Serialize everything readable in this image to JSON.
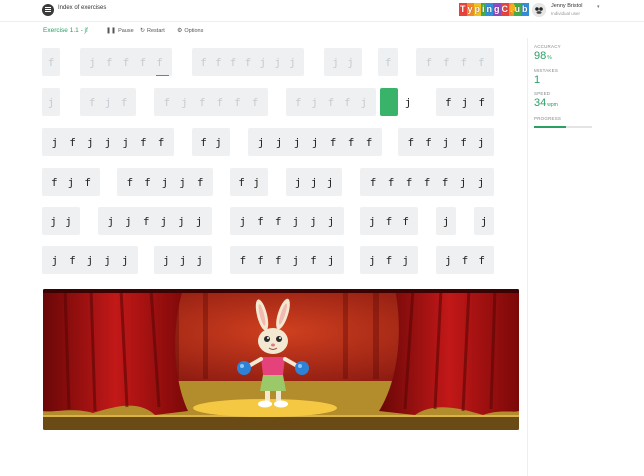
{
  "header": {
    "index_label": "Index of exercises",
    "logo_letters": [
      "T",
      "y",
      "p",
      "i",
      "n",
      "g",
      "C",
      "l",
      "u",
      "b"
    ],
    "logo_colors": [
      "#e8433b",
      "#f08a2b",
      "#f0c21f",
      "#3fae49",
      "#2f8fd8",
      "#8a4cc4",
      "#e8433b",
      "#f08a2b",
      "#3fae49",
      "#2f8fd8"
    ],
    "user_name": "Jenny Bristol",
    "user_type": "Individual user"
  },
  "toolbar": {
    "exercise_title": "Exercise 1.1 - jf",
    "pause_label": "Pause",
    "restart_label": "Restart",
    "options_label": "Options"
  },
  "stats": {
    "accuracy_label": "ACCURACY",
    "accuracy_value": "98",
    "accuracy_unit": "%",
    "mistakes_label": "MISTAKES",
    "mistakes_value": "1",
    "speed_label": "SPEED",
    "speed_value": "34",
    "speed_unit": "wpm",
    "progress_label": "PROGRESS",
    "progress_fraction": 0.55
  },
  "words": {
    "rows": [
      [
        {
          "text": "f",
          "state": "done"
        },
        {
          "text": "jffff",
          "state": "done"
        },
        {
          "text": "ffffjjj",
          "state": "done"
        },
        {
          "text": "jj",
          "state": "done"
        },
        {
          "text": "f",
          "state": "done"
        },
        {
          "text": "ffff",
          "state": "done"
        }
      ],
      [
        {
          "text": "j",
          "state": "done"
        },
        {
          "text": "fjf",
          "state": "done"
        },
        {
          "text": "fjffff",
          "state": "done"
        },
        {
          "text": "fjffj",
          "state": "done"
        },
        {
          "text": "j",
          "state": "current"
        },
        {
          "text": "fjf",
          "state": "todo"
        }
      ],
      [
        {
          "text": "jfjjjff",
          "state": "todo"
        },
        {
          "text": "fj",
          "state": "todo"
        },
        {
          "text": "jjjjfff",
          "state": "todo"
        },
        {
          "text": "ffjfj",
          "state": "todo"
        }
      ],
      [
        {
          "text": "fjf",
          "state": "todo"
        },
        {
          "text": "ffjjf",
          "state": "todo"
        },
        {
          "text": "fj",
          "state": "todo"
        },
        {
          "text": "jjj",
          "state": "todo"
        },
        {
          "text": "fffffjj",
          "state": "todo"
        }
      ],
      [
        {
          "text": "jj",
          "state": "todo"
        },
        {
          "text": "jjfjjj",
          "state": "todo"
        },
        {
          "text": "jffjjj",
          "state": "todo"
        },
        {
          "text": "jff",
          "state": "todo"
        },
        {
          "text": "j",
          "state": "todo"
        },
        {
          "text": "j",
          "state": "todo"
        }
      ],
      [
        {
          "text": "jfjjj",
          "state": "todo"
        },
        {
          "text": "jjj",
          "state": "todo"
        },
        {
          "text": "fffjfj",
          "state": "todo"
        },
        {
          "text": "jfj",
          "state": "todo"
        },
        {
          "text": "jff",
          "state": "todo"
        }
      ]
    ]
  }
}
